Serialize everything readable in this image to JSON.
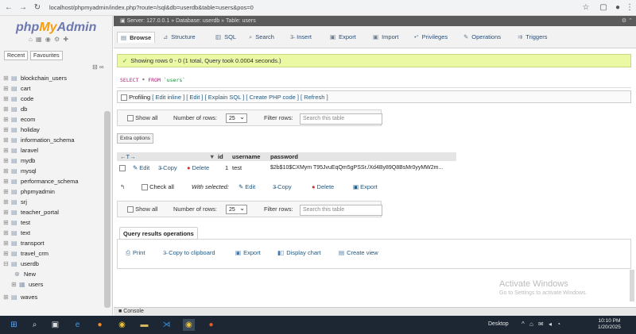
{
  "browser": {
    "url": "localhost/phpmyadmin/index.php?route=/sql&db=userdb&table=users&pos=0"
  },
  "sidebar": {
    "logo_php": "php",
    "logo_my": "My",
    "logo_admin": "Admin",
    "tabs": [
      "Recent",
      "Favourites"
    ],
    "databases": [
      "blockchain_users",
      "cart",
      "code",
      "db",
      "ecom",
      "holiday",
      "information_schema",
      "laravel",
      "mydb",
      "mysql",
      "performance_schema",
      "phpmyadmin",
      "srj",
      "teacher_portal",
      "test",
      "text",
      "transport",
      "travel_crm",
      "userdb"
    ],
    "userdb_children": [
      "New",
      "users"
    ],
    "last_db": "waves"
  },
  "breadcrumb": {
    "server": "Server: 127.0.0.1",
    "database": "Database: userdb",
    "table": "Table: users"
  },
  "tabs": [
    "Browse",
    "Structure",
    "SQL",
    "Search",
    "Insert",
    "Export",
    "Import",
    "Privileges",
    "Operations",
    "Triggers"
  ],
  "message": "Showing rows 0 - 0 (1 total, Query took 0.0004 seconds.)",
  "sql": {
    "kw1": "SELECT",
    "star": " * ",
    "kw2": "FROM",
    "table": " `users`"
  },
  "profiling": {
    "label": "Profiling",
    "links": "[ Edit inline ] [ Edit ] [ Explain SQL ] [ Create PHP code ] [ Refresh ]"
  },
  "nav": {
    "show_all": "Show all",
    "rows_label": "Number of rows:",
    "rows_value": "25",
    "filter_label": "Filter rows:",
    "filter_placeholder": "Search this table"
  },
  "extra_options": "Extra options",
  "table": {
    "arrows": "←T→",
    "sort_mark": "▼",
    "columns": [
      "id",
      "username",
      "password"
    ],
    "row": {
      "edit": "Edit",
      "copy": "Copy",
      "delete": "Delete",
      "id": "1",
      "username": "test",
      "password": "$2b$10$CXMym T95JvuEqQm5gPSSr./Xd4By89Q8BsMr0yyMW2m..."
    }
  },
  "with_selected": {
    "check_all": "Check all",
    "label": "With selected:",
    "edit": "Edit",
    "copy": "Copy",
    "delete": "Delete",
    "export": "Export"
  },
  "query_ops": {
    "legend": "Query results operations",
    "items": [
      "Print",
      "Copy to clipboard",
      "Export",
      "Display chart",
      "Create view"
    ]
  },
  "watermark": {
    "line1": "Activate Windows",
    "line2": "Go to Settings to activate Windows."
  },
  "console": "Console",
  "taskbar": {
    "desktop": "Desktop",
    "time": "10:10 PM",
    "date": "1/20/2025"
  }
}
